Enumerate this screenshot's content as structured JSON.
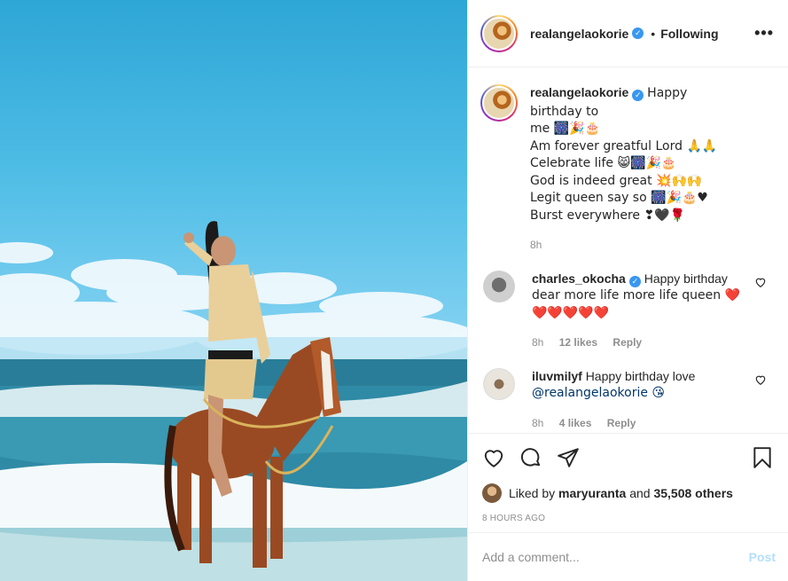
{
  "post": {
    "author": "realangelaokorie",
    "follow_sep": "•",
    "follow_label": "Following",
    "more_label": "•••"
  },
  "caption": {
    "author": "realangelaokorie",
    "lines": [
      "Happy birthday to",
      "me 🎆🎉🎂",
      "Am forever greatful Lord 🙏🙏",
      "Celebrate life 😸🎆🎉🎂",
      "God is indeed great 💥🙌🙌",
      "Legit queen say so 🎆🎉🎂♥",
      "Burst everywhere ❣🖤🌹"
    ],
    "time": "8h"
  },
  "comments": [
    {
      "author": "charles_okocha",
      "verified": true,
      "lines": [
        "Happy birthday",
        "dear more life more life queen ❤️",
        "❤️❤️❤️❤️❤️"
      ],
      "time": "8h",
      "likes": "12 likes",
      "reply": "Reply"
    },
    {
      "author": "iluvmilyf",
      "verified": false,
      "lines": [
        "Happy birthday love",
        "@realangelaokorie 😘"
      ],
      "mention": "@realangelaokorie",
      "time": "8h",
      "likes": "4 likes",
      "reply": "Reply"
    }
  ],
  "likes": {
    "prefix": "Liked by",
    "user": "maryuranta",
    "and": "and",
    "others": "35,508 others"
  },
  "timestamp": "8 HOURS AGO",
  "add_comment": {
    "placeholder": "Add a comment...",
    "post_label": "Post"
  },
  "colors": {
    "verified": "#3897f0",
    "post_button_disabled": "#b2dffc",
    "mention": "#00376b",
    "meta_gray": "#8e8e8e"
  },
  "icons": [
    "heart-icon",
    "comment-icon",
    "share-icon",
    "bookmark-icon",
    "verified-icon",
    "more-icon"
  ]
}
